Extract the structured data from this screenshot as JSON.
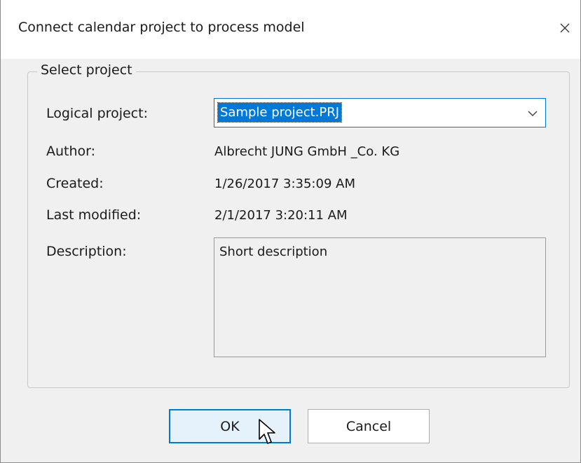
{
  "window": {
    "title": "Connect calendar project to process model",
    "close_glyph": "✕"
  },
  "group": {
    "legend": "Select project"
  },
  "fields": {
    "logical_project_label": "Logical project:",
    "logical_project_value": "Sample project.PRJ",
    "author_label": "Author:",
    "author_value": "Albrecht JUNG GmbH _Co. KG",
    "created_label": "Created:",
    "created_value": "1/26/2017 3:35:09 AM",
    "modified_label": "Last modified:",
    "modified_value": "2/1/2017 3:20:11 AM",
    "description_label": "Description:",
    "description_value": "Short description"
  },
  "buttons": {
    "ok_label": "OK",
    "cancel_label": "Cancel"
  },
  "icons": {
    "close": "close-icon",
    "dropdown": "chevron-down-icon",
    "cursor": "mouse-pointer-icon"
  },
  "colors": {
    "accent": "#0078d7",
    "dialog_background": "#f0f0f0",
    "titlebar_background": "#ffffff",
    "ok_button_background": "#e5f1fb"
  }
}
